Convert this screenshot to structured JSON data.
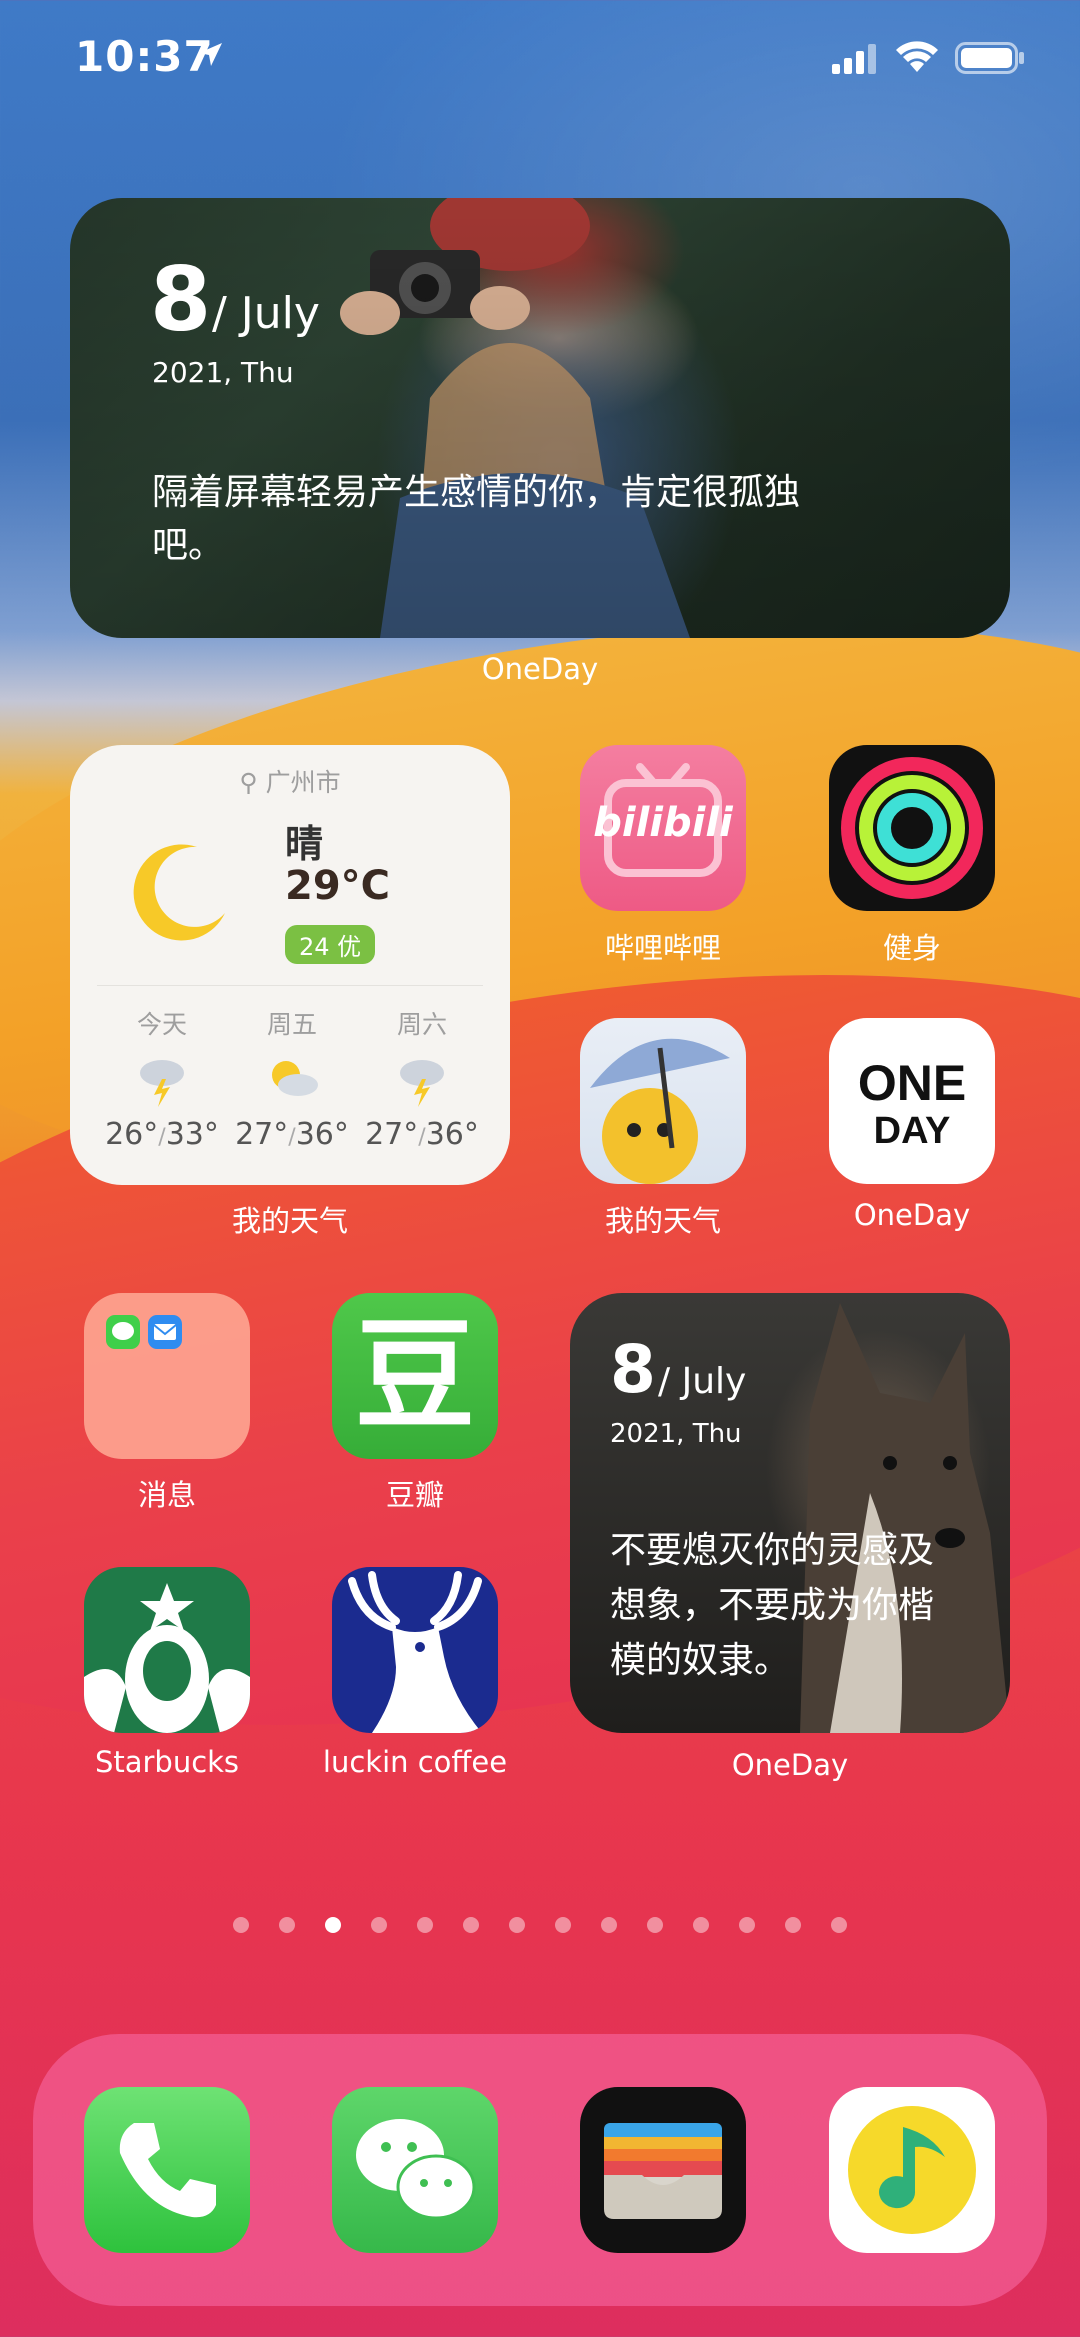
{
  "status_bar": {
    "time": "10:37"
  },
  "widgets": {
    "oneday_top": {
      "day": "8",
      "month": "/ July",
      "date": "2021, Thu",
      "quote_line1": "隔着屏幕轻易产生感情的你，肯定很孤独",
      "quote_line2": "吧。",
      "label": "OneDay"
    },
    "weather": {
      "location": "广州市",
      "condition": "晴",
      "temperature": "29°C",
      "aqi": "24 优",
      "forecast": [
        {
          "day": "今天",
          "icon": "thunderstorm-icon",
          "low": "26°",
          "high": "33°"
        },
        {
          "day": "周五",
          "icon": "partly-cloudy-icon",
          "low": "27°",
          "high": "36°"
        },
        {
          "day": "周六",
          "icon": "thunderstorm-icon",
          "low": "27°",
          "high": "36°"
        }
      ],
      "label": "我的天气"
    },
    "oneday_bottom": {
      "day": "8",
      "month": "/ July",
      "date": "2021, Thu",
      "quote_line1": "不要熄灭你的灵感及",
      "quote_line2": "想象，不要成为你楷",
      "quote_line3": "模的奴隶。",
      "label": "OneDay"
    }
  },
  "apps": {
    "bilibili": {
      "label": "哔哩哔哩",
      "logo_text": "bilibili"
    },
    "fitness": {
      "label": "健身"
    },
    "my_weather": {
      "label": "我的天气"
    },
    "oneday": {
      "label": "OneDay",
      "logo_line1": "ONE",
      "logo_line2": "DAY"
    },
    "messages_folder": {
      "label": "消息"
    },
    "douban": {
      "label": "豆瓣",
      "logo_text": "豆"
    },
    "starbucks": {
      "label": "Starbucks"
    },
    "luckin": {
      "label": "luckin coffee"
    }
  },
  "pager": {
    "count": 14,
    "active_index": 2
  },
  "dock": [
    {
      "name": "phone",
      "icon": "phone-icon"
    },
    {
      "name": "wechat",
      "icon": "wechat-icon"
    },
    {
      "name": "wallet",
      "icon": "wallet-icon"
    },
    {
      "name": "qq-music",
      "icon": "music-note-icon"
    }
  ],
  "colors": {
    "weather_aqi": "#7bc043",
    "bilibili": "#f26a91",
    "douban": "#3db43a",
    "starbucks": "#1e7c4a",
    "luckin": "#1a2a8f",
    "phone": "#3fcf4a",
    "wechat": "#44c25a"
  }
}
